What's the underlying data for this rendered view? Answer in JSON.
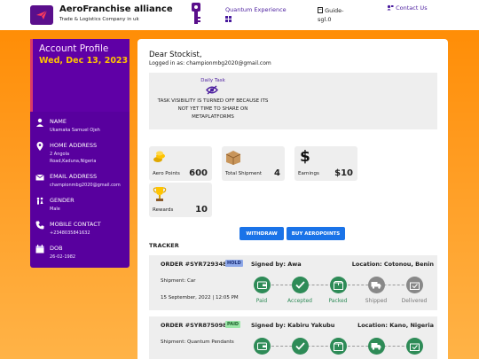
{
  "header": {
    "brand_title": "AeroFranchise alliance",
    "brand_subtitle": "Trade & Logistics Company in uk",
    "nav_quantum": "Quantum Experience",
    "nav_guide": "Guide-sgl.0",
    "nav_contact": "Contact Us"
  },
  "profile": {
    "title": "Account Profile",
    "date": "Wed, Dec 13, 2023",
    "fields": [
      {
        "label": "NAME",
        "value": "Ukamaka Samuel Ojeh",
        "icon": "user-icon"
      },
      {
        "label": "HOME ADDRESS",
        "value": "2 Angola",
        "value2": "Road,Kaduna,Nigeria",
        "icon": "location-pin-icon"
      },
      {
        "label": "EMAIL ADDRESS",
        "value": "championmbg2020@gmail.com",
        "icon": "envelope-icon"
      },
      {
        "label": "GENDER",
        "value": "Male",
        "icon": "gender-icon"
      },
      {
        "label": "MOBILE CONTACT",
        "value": "+2348035841632",
        "icon": "phone-icon"
      },
      {
        "label": "DOB",
        "value": "26-02-1982",
        "icon": "calendar-icon"
      }
    ]
  },
  "main": {
    "greeting": "Dear Stockist,",
    "logged_in": "Logged in as: championmbg2020@gmail.com",
    "task_title": "Daily Task",
    "task_message": "TASK VISIBILITY IS TURNED OFF BECAUSE ITS NOT YET TIME TO SHARE ON METAPLATFORMS"
  },
  "stats": [
    {
      "label": "Aero Points",
      "value": "600",
      "icon": "coins-icon"
    },
    {
      "label": "Total Shipment",
      "value": "4",
      "icon": "box-icon"
    },
    {
      "label": "Earnings",
      "value": "$10",
      "icon": "dollar-icon"
    },
    {
      "label": "Rewards",
      "value": "10",
      "icon": "trophy-icon"
    }
  ],
  "buttons": {
    "withdraw": "WITHDRAW",
    "buy": "BUY AEROPOINTS"
  },
  "tracker": {
    "title": "TRACKER",
    "orders": [
      {
        "id": "ORDER #SYR729348",
        "status": "HOLD",
        "signed": "Signed by: Awa",
        "location": "Location: Cotonou, Benin",
        "shipment": "Shipment: Car",
        "date": "15 September, 2022 | 12:05 PM",
        "steps": [
          "Paid",
          "Accepted",
          "Packed",
          "Shipped",
          "Delivered"
        ]
      },
      {
        "id": "ORDER #SYR875098",
        "status": "PAID",
        "signed": "Signed by: Kabiru Yakubu",
        "location": "Location: Kano, Nigeria",
        "shipment": "Shipment: Quantum Pendants",
        "date": "",
        "steps": [
          "",
          "",
          "",
          "",
          ""
        ]
      }
    ]
  },
  "colors": {
    "brand_purple": "#5a0f8c",
    "accent_orange": "#ff8a00",
    "date_yellow": "#ffc400",
    "button_blue": "#1a73e8",
    "step_green": "#2e8b57",
    "step_gray": "#888888",
    "hold_badge": "#8ea8e8",
    "paid_badge": "#9be6a8"
  }
}
